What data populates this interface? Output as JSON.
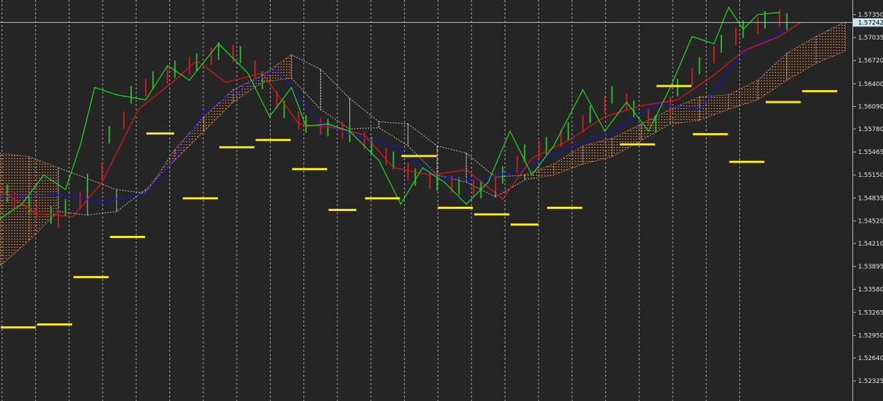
{
  "colors": {
    "background": "#252525",
    "grid": "#d8d8d8",
    "axis": "#bfbfbf",
    "tick_text": "#e6e6e6",
    "price_line": "#c8c8c8",
    "price_tag_bg": "#cde8ee",
    "kijun": "#1515c8",
    "tenkan": "#d01818",
    "chikou": "#22e022",
    "kumo_bull": "#e8a070",
    "kumo_bear": "#e8e8e8",
    "candles_up": "#2fb82f",
    "candles_down": "#c82020",
    "levels": "#ffee22"
  },
  "chart_data": {
    "type": "line",
    "title": "",
    "xlabel": "",
    "ylabel": "",
    "ylim": [
      1.5205,
      1.5755
    ],
    "y_ticks": [
      "1.57350",
      "1.57035",
      "1.56720",
      "1.56400",
      "1.56090",
      "1.55780",
      "1.55465",
      "1.55150",
      "1.54835",
      "1.54520",
      "1.54210",
      "1.53895",
      "1.53580",
      "1.53265",
      "1.52950",
      "1.52640",
      "1.52325"
    ],
    "y_tick_values": [
      1.5735,
      1.57035,
      1.5672,
      1.564,
      1.5609,
      1.5578,
      1.55465,
      1.5515,
      1.54835,
      1.5452,
      1.5421,
      1.53895,
      1.5358,
      1.53265,
      1.5295,
      1.5264,
      1.52325
    ],
    "current_price": "1.57242",
    "current_price_value": 1.57242,
    "period_separators": 23,
    "x_range": [
      0,
      117
    ],
    "series": [
      {
        "kind": "kijun",
        "x": [
          0,
          8,
          14,
          20,
          24,
          28,
          32,
          38,
          44,
          48,
          54,
          60,
          66,
          72,
          78,
          84,
          90,
          96,
          102,
          108
        ],
        "values": [
          1.5485,
          1.5488,
          1.5478,
          1.549,
          1.5538,
          1.5602,
          1.5628,
          1.566,
          1.5585,
          1.5571,
          1.5555,
          1.5512,
          1.5508,
          1.5525,
          1.5552,
          1.5575,
          1.5612,
          1.5605,
          1.5683,
          1.5715
        ]
      },
      {
        "kind": "tenkan",
        "x": [
          0,
          5,
          10,
          14,
          19,
          24,
          27,
          31,
          36,
          41,
          46,
          50,
          54,
          59,
          64,
          69,
          73,
          78,
          83,
          88,
          93,
          98,
          102,
          107,
          110
        ],
        "values": [
          1.5495,
          1.5462,
          1.5458,
          1.5505,
          1.5605,
          1.5645,
          1.5672,
          1.5642,
          1.5655,
          1.5585,
          1.558,
          1.557,
          1.5525,
          1.5515,
          1.5522,
          1.5482,
          1.5538,
          1.5562,
          1.5595,
          1.561,
          1.5618,
          1.5652,
          1.5685,
          1.5705,
          1.5725
        ]
      },
      {
        "kind": "chikou",
        "x": [
          0,
          3,
          6,
          9,
          11,
          13,
          16,
          20,
          23,
          26,
          30,
          34,
          37,
          40,
          42,
          45,
          48,
          52,
          55,
          58,
          61,
          64,
          67,
          70,
          73,
          76,
          80,
          83,
          86,
          89,
          92,
          95,
          98,
          100,
          102,
          104,
          107
        ],
        "values": [
          1.5455,
          1.5475,
          1.5515,
          1.5495,
          1.5555,
          1.5635,
          1.5625,
          1.5618,
          1.5665,
          1.5645,
          1.5695,
          1.5655,
          1.5595,
          1.5635,
          1.5582,
          1.5585,
          1.5575,
          1.5535,
          1.5475,
          1.5525,
          1.5505,
          1.5475,
          1.5505,
          1.5575,
          1.5515,
          1.5555,
          1.5632,
          1.5575,
          1.5615,
          1.5575,
          1.5635,
          1.5705,
          1.5695,
          1.5745,
          1.5715,
          1.5735,
          1.5738
        ]
      },
      {
        "kind": "kumo_top",
        "x": [
          0,
          4,
          8,
          12,
          16,
          20,
          24,
          28,
          32,
          36,
          40,
          44,
          48,
          52,
          56,
          60,
          64,
          68,
          72,
          76,
          80,
          84,
          88,
          92,
          96,
          100,
          104,
          108,
          112,
          116
        ],
        "values": [
          1.5545,
          1.554,
          1.5525,
          1.551,
          1.5495,
          1.549,
          1.555,
          1.5595,
          1.5632,
          1.5652,
          1.568,
          1.566,
          1.562,
          1.5588,
          1.5585,
          1.5555,
          1.5545,
          1.5512,
          1.5515,
          1.553,
          1.5555,
          1.5565,
          1.5585,
          1.5605,
          1.5622,
          1.5625,
          1.5645,
          1.5682,
          1.5705,
          1.5725
        ]
      },
      {
        "kind": "kumo_bottom",
        "x": [
          0,
          4,
          8,
          12,
          16,
          20,
          24,
          28,
          32,
          36,
          40,
          44,
          48,
          52,
          56,
          60,
          64,
          68,
          72,
          76,
          80,
          84,
          88,
          92,
          96,
          100,
          104,
          108,
          112,
          116
        ],
        "values": [
          1.539,
          1.5425,
          1.5465,
          1.546,
          1.5465,
          1.5495,
          1.5535,
          1.5575,
          1.5615,
          1.5642,
          1.5648,
          1.5605,
          1.5578,
          1.558,
          1.5555,
          1.5515,
          1.5505,
          1.5485,
          1.5508,
          1.5515,
          1.553,
          1.554,
          1.5562,
          1.5585,
          1.559,
          1.5605,
          1.5618,
          1.5645,
          1.5668,
          1.5685
        ]
      },
      {
        "kind": "candles_up",
        "x": [
          1,
          4,
          7,
          9,
          12,
          15,
          18,
          21,
          24,
          27,
          30,
          33,
          36,
          39,
          42,
          45,
          48,
          51,
          54,
          57,
          60,
          63,
          66,
          69,
          72,
          75,
          78,
          81,
          84,
          87,
          90,
          93,
          96,
          99,
          102,
          105,
          108
        ],
        "values": [
          1.549,
          1.5475,
          1.546,
          1.547,
          1.5505,
          1.557,
          1.5625,
          1.5645,
          1.566,
          1.567,
          1.5685,
          1.568,
          1.5645,
          1.5605,
          1.5585,
          1.558,
          1.5572,
          1.5555,
          1.5535,
          1.5512,
          1.5505,
          1.55,
          1.5495,
          1.5515,
          1.5545,
          1.5555,
          1.5575,
          1.5598,
          1.5625,
          1.5605,
          1.5585,
          1.5635,
          1.5665,
          1.5695,
          1.5715,
          1.5728,
          1.5725
        ]
      },
      {
        "kind": "candles_down",
        "x": [
          2,
          5,
          8,
          11,
          14,
          17,
          20,
          23,
          26,
          29,
          32,
          35,
          38,
          41,
          44,
          47,
          50,
          53,
          56,
          59,
          62,
          65,
          68,
          71,
          74,
          77,
          80,
          83,
          86,
          89,
          92,
          95,
          98,
          101,
          104,
          107
        ],
        "values": [
          1.548,
          1.5468,
          1.5455,
          1.548,
          1.552,
          1.559,
          1.5635,
          1.5652,
          1.5665,
          1.5678,
          1.5682,
          1.566,
          1.5618,
          1.559,
          1.5582,
          1.5576,
          1.5562,
          1.554,
          1.552,
          1.5508,
          1.5502,
          1.5498,
          1.5505,
          1.553,
          1.555,
          1.5565,
          1.5585,
          1.5612,
          1.5615,
          1.5595,
          1.561,
          1.565,
          1.568,
          1.5705,
          1.572,
          1.573
        ]
      },
      {
        "kind": "levels",
        "segments": [
          {
            "x": [
              0,
              5
            ],
            "value": 1.5306
          },
          {
            "x": [
              5,
              10
            ],
            "value": 1.531
          },
          {
            "x": [
              10,
              15
            ],
            "value": 1.5375
          },
          {
            "x": [
              15,
              20
            ],
            "value": 1.543
          },
          {
            "x": [
              20,
              24
            ],
            "value": 1.5572
          },
          {
            "x": [
              25,
              30
            ],
            "value": 1.5483
          },
          {
            "x": [
              30,
              35
            ],
            "value": 1.5553
          },
          {
            "x": [
              35,
              40
            ],
            "value": 1.5563
          },
          {
            "x": [
              40,
              45
            ],
            "value": 1.5523
          },
          {
            "x": [
              45,
              49
            ],
            "value": 1.5467
          },
          {
            "x": [
              50,
              55
            ],
            "value": 1.5483
          },
          {
            "x": [
              55,
              60
            ],
            "value": 1.5541
          },
          {
            "x": [
              60,
              65
            ],
            "value": 1.547
          },
          {
            "x": [
              65,
              70
            ],
            "value": 1.5461
          },
          {
            "x": [
              70,
              74
            ],
            "value": 1.5447
          },
          {
            "x": [
              75,
              80
            ],
            "value": 1.547
          },
          {
            "x": [
              85,
              90
            ],
            "value": 1.5557
          },
          {
            "x": [
              90,
              95
            ],
            "value": 1.5637
          },
          {
            "x": [
              95,
              100
            ],
            "value": 1.5571
          },
          {
            "x": [
              100,
              105
            ],
            "value": 1.5533
          },
          {
            "x": [
              105,
              110
            ],
            "value": 1.5615
          },
          {
            "x": [
              110,
              115
            ],
            "value": 1.563
          }
        ]
      }
    ]
  }
}
